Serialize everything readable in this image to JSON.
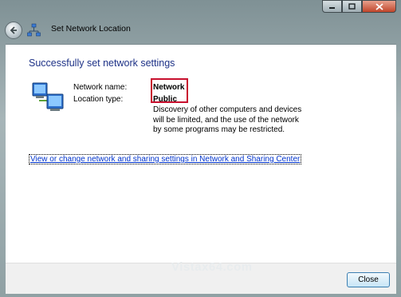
{
  "window": {
    "title": "Set Network Location"
  },
  "caption": {
    "minimize": "–",
    "maximize": "□",
    "close": "✕"
  },
  "main": {
    "heading": "Successfully set network settings",
    "network_name_label": "Network name:",
    "network_name_value": "Network",
    "location_type_label": "Location type:",
    "location_type_value": "Public",
    "description": "Discovery of other computers and devices will be limited, and the use of the network by some programs may be restricted.",
    "link": "View or change network and sharing settings in Network and Sharing Center"
  },
  "watermark": "Vistax64.com",
  "footer": {
    "close_label": "Close"
  },
  "colors": {
    "heading": "#1e3287",
    "link": "#0033cc",
    "highlight": "#c8102e"
  }
}
